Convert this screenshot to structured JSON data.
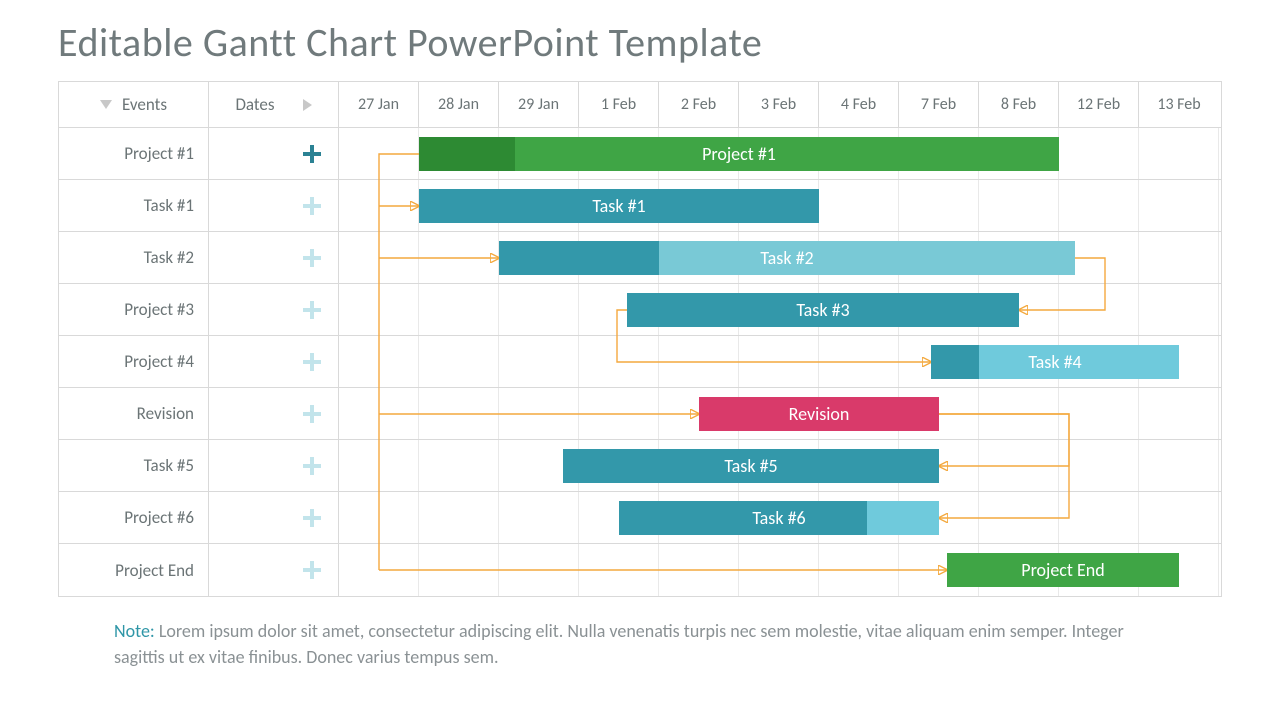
{
  "title": "Editable Gantt Chart PowerPoint Template",
  "columns": {
    "events": "Events",
    "dates": "Dates"
  },
  "dates": [
    "27 Jan",
    "28 Jan",
    "29 Jan",
    "1 Feb",
    "2 Feb",
    "3 Feb",
    "4 Feb",
    "7 Feb",
    "8 Feb",
    "12 Feb",
    "13 Feb"
  ],
  "rows": [
    {
      "label": "Project #1",
      "plus": "dark"
    },
    {
      "label": "Task #1",
      "plus": "light"
    },
    {
      "label": "Task #2",
      "plus": "light"
    },
    {
      "label": "Project #3",
      "plus": "light"
    },
    {
      "label": "Project #4",
      "plus": "light"
    },
    {
      "label": "Revision",
      "plus": "light"
    },
    {
      "label": "Task #5",
      "plus": "light"
    },
    {
      "label": "Project #6",
      "plus": "light"
    },
    {
      "label": "Project End",
      "plus": "light"
    }
  ],
  "note_label": "Note:",
  "note_text": "Lorem ipsum dolor sit amet, consectetur adipiscing elit. Nulla venenatis turpis nec sem molestie, vitae aliquam enim semper. Integer sagittis ut ex vitae finibus. Donec varius tempus sem.",
  "colors": {
    "green": "#3fa545",
    "green_dark": "#2d8a33",
    "teal": "#3398aa",
    "teal_light": "#79c9d6",
    "sky": "#6fcadc",
    "pink": "#d93a6a",
    "orange": "#f4a93f"
  },
  "chart_data": {
    "type": "gantt",
    "title": "Editable Gantt Chart PowerPoint Template",
    "x_categories": [
      "27 Jan",
      "28 Jan",
      "29 Jan",
      "1 Feb",
      "2 Feb",
      "3 Feb",
      "4 Feb",
      "7 Feb",
      "8 Feb",
      "12 Feb",
      "13 Feb"
    ],
    "tasks": [
      {
        "row": 0,
        "label": "Project #1",
        "start": 1,
        "end": 9,
        "color": "green",
        "progress_end": 2.2,
        "progress_color": "green_dark"
      },
      {
        "row": 1,
        "label": "Task #1",
        "start": 1,
        "end": 6,
        "color": "teal"
      },
      {
        "row": 2,
        "label": "Task #2",
        "start": 2,
        "end": 9.2,
        "color": "teal_light",
        "progress_end": 4,
        "progress_color": "teal"
      },
      {
        "row": 3,
        "label": "Task #3",
        "start": 3.6,
        "end": 8.5,
        "color": "teal"
      },
      {
        "row": 4,
        "label": "Task #4",
        "start": 7.4,
        "end": 10.5,
        "color": "sky",
        "progress_end": 8,
        "progress_color": "teal"
      },
      {
        "row": 5,
        "label": "Revision",
        "start": 4.5,
        "end": 7.5,
        "color": "pink"
      },
      {
        "row": 6,
        "label": "Task #5",
        "start": 2.8,
        "end": 7.5,
        "color": "teal"
      },
      {
        "row": 7,
        "label": "Task #6",
        "start": 3.5,
        "end": 7.5,
        "color": "sky",
        "progress_end": 6.6,
        "progress_color": "teal"
      },
      {
        "row": 8,
        "label": "Project End",
        "start": 7.6,
        "end": 10.5,
        "color": "green"
      }
    ],
    "dependencies": [
      {
        "from_row": 0,
        "from_col": 1,
        "from_side": "start",
        "to_row": 1,
        "to_side": "start"
      },
      {
        "from_row": 0,
        "from_col": 1,
        "from_side": "start",
        "to_row": 2,
        "to_side": "start"
      },
      {
        "from_row": 2,
        "from_col": 9.2,
        "from_side": "end",
        "to_row": 3,
        "to_side": "end"
      },
      {
        "from_row": 3,
        "from_col": 3.6,
        "from_side": "start",
        "to_row": 4,
        "to_side": "start"
      },
      {
        "from_row": 0,
        "from_col": 1,
        "from_side": "start",
        "to_row": 5,
        "to_side": "start"
      },
      {
        "from_row": 5,
        "from_col": 7.5,
        "from_side": "end",
        "to_row": 6,
        "to_side": "end",
        "via_col": 9
      },
      {
        "from_row": 5,
        "from_col": 7.5,
        "from_side": "end",
        "to_row": 7,
        "to_side": "end",
        "via_col": 9
      },
      {
        "from_row": 0,
        "from_col": 1,
        "from_side": "start",
        "to_row": 8,
        "to_side": "start"
      }
    ]
  }
}
